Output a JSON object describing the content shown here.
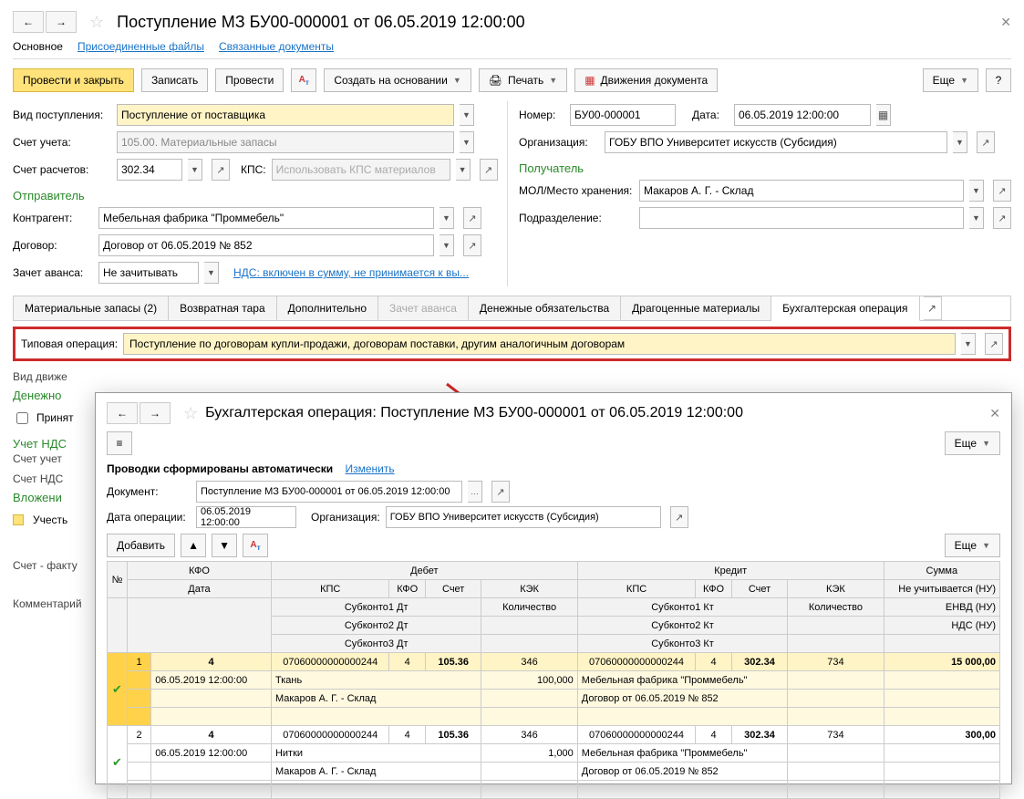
{
  "header": {
    "title": "Поступление МЗ БУ00-000001 от 06.05.2019 12:00:00"
  },
  "topTabs": {
    "main": "Основное",
    "files": "Присоединенные файлы",
    "linked": "Связанные документы"
  },
  "toolbar": {
    "postClose": "Провести и закрыть",
    "save": "Записать",
    "post": "Провести",
    "createBased": "Создать на основании",
    "print": "Печать",
    "movements": "Движения документа",
    "more": "Еще",
    "help": "?"
  },
  "form": {
    "receiptTypeLbl": "Вид поступления:",
    "receiptType": "Поступление от поставщика",
    "accountLbl": "Счет учета:",
    "account": "105.00. Материальные запасы",
    "settleAccLbl": "Счет расчетов:",
    "settleAcc": "302.34",
    "kpsLbl": "КПС:",
    "kpsPlaceholder": "Использовать КПС материалов",
    "senderH": "Отправитель",
    "counterpartyLbl": "Контрагент:",
    "counterparty": "Мебельная фабрика \"Проммебель\"",
    "contractLbl": "Договор:",
    "contract": "Договор от 06.05.2019 № 852",
    "advanceLbl": "Зачет аванса:",
    "advance": "Не зачитывать",
    "vatLink": "НДС: включен в сумму, не принимается к вы...",
    "numberLbl": "Номер:",
    "number": "БУ00-000001",
    "dateLbl": "Дата:",
    "date": "06.05.2019 12:00:00",
    "orgLbl": "Организация:",
    "org": "ГОБУ ВПО Университет искусств (Субсидия)",
    "receiverH": "Получатель",
    "molLbl": "МОЛ/Место хранения:",
    "mol": "Макаров А. Г. - Склад",
    "deptLbl": "Подразделение:"
  },
  "midTabs": {
    "t1": "Материальные запасы (2)",
    "t2": "Возвратная тара",
    "t3": "Дополнительно",
    "t4": "Зачет аванса",
    "t5": "Денежные обязательства",
    "t6": "Драгоценные материалы",
    "t7": "Бухгалтерская операция"
  },
  "typOp": {
    "lbl": "Типовая операция:",
    "val": "Поступление по договорам купли-продажи, договорам поставки, другим аналогичным договорам"
  },
  "below": {
    "moveType": "Вид движе",
    "cash": "Денежно",
    "accept": "Принят",
    "vat": "Учет НДС",
    "vatAcc": "Счет учет",
    "vatAcc2": "Счет НДС",
    "inv": "Вложени",
    "incl": "Учесть",
    "invoice": "Счет - факту",
    "comment": "Комментарий"
  },
  "sub": {
    "title": "Бухгалтерская операция: Поступление МЗ БУ00-000001 от 06.05.2019 12:00:00",
    "note": "Проводки сформированы автоматически",
    "change": "Изменить",
    "docLbl": "Документ:",
    "doc": "Поступление МЗ БУ00-000001 от 06.05.2019 12:00:00",
    "opDateLbl": "Дата операции:",
    "opDate": "06.05.2019 12:00:00",
    "orgLbl": "Организация:",
    "org": "ГОБУ ВПО Университет искусств (Субсидия)",
    "add": "Добавить",
    "more": "Еще"
  },
  "table": {
    "h_num": "№",
    "h_kfo": "КФО",
    "h_date": "Дата",
    "h_debit": "Дебет",
    "h_credit": "Кредит",
    "h_sum": "Сумма",
    "h_kps": "КПС",
    "h_acc": "Счет",
    "h_kek": "КЭК",
    "h_qty": "Количество",
    "h_sub1d": "Субконто1 Дт",
    "h_sub2d": "Субконто2 Дт",
    "h_sub3d": "Субконто3 Дт",
    "h_sub1k": "Субконто1 Кт",
    "h_sub2k": "Субконто2 Кт",
    "h_sub3k": "Субконто3 Кт",
    "h_nu": "Не учитывается (НУ)",
    "h_envd": "ЕНВД (НУ)",
    "h_nds": "НДС (НУ)"
  },
  "rows": [
    {
      "n": "1",
      "kfo": "4",
      "date": "06.05.2019 12:00:00",
      "d_kps": "07060000000000244",
      "d_kfo": "4",
      "d_acc": "105.36",
      "d_kek": "346",
      "d_qty": "100,000",
      "d_sub1": "Ткань",
      "d_sub2": "Макаров А. Г. - Склад",
      "k_kps": "07060000000000244",
      "k_kfo": "4",
      "k_acc": "302.34",
      "k_kek": "734",
      "k_sub1": "Мебельная фабрика \"Проммебель\"",
      "k_sub2": "Договор от 06.05.2019 № 852",
      "sum": "15 000,00"
    },
    {
      "n": "2",
      "kfo": "4",
      "date": "06.05.2019 12:00:00",
      "d_kps": "07060000000000244",
      "d_kfo": "4",
      "d_acc": "105.36",
      "d_kek": "346",
      "d_qty": "1,000",
      "d_sub1": "Нитки",
      "d_sub2": "Макаров А. Г. - Склад",
      "k_kps": "07060000000000244",
      "k_kfo": "4",
      "k_acc": "302.34",
      "k_kek": "734",
      "k_sub1": "Мебельная фабрика \"Проммебель\"",
      "k_sub2": "Договор от 06.05.2019 № 852",
      "sum": "300,00"
    }
  ]
}
